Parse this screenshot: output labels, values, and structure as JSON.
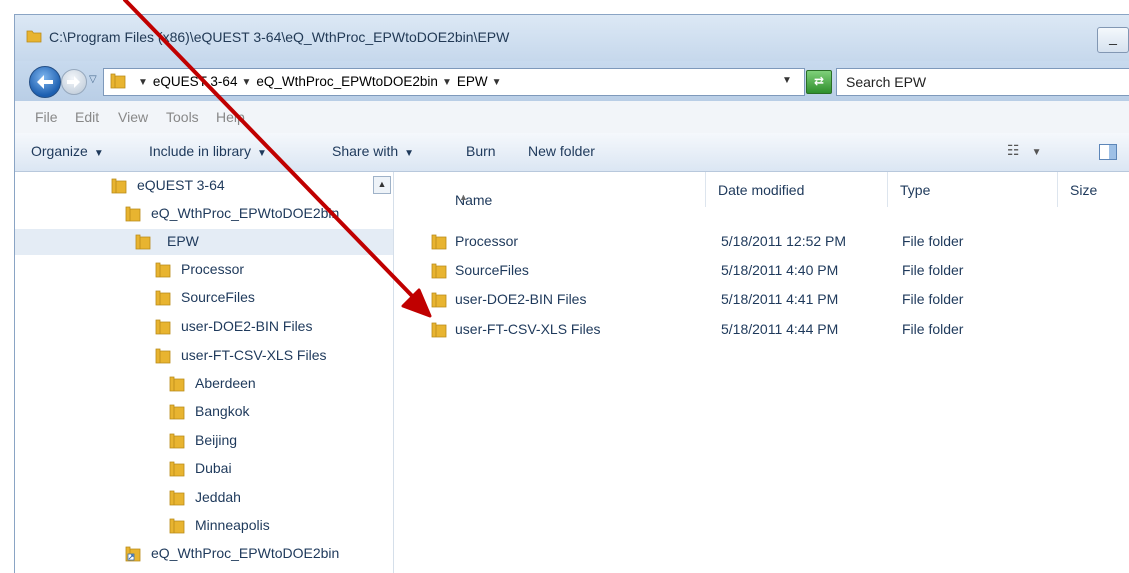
{
  "window": {
    "title": "C:\\Program Files (x86)\\eQUEST 3-64\\eQ_WthProc_EPWtoDOE2bin\\EPW",
    "minimize_label": "_"
  },
  "address": {
    "crumbs": [
      "eQUEST 3-64",
      "eQ_WthProc_EPWtoDOE2bin",
      "EPW"
    ],
    "search_placeholder": "Search EPW"
  },
  "menu": [
    "File",
    "Edit",
    "View",
    "Tools",
    "Help"
  ],
  "toolbar": {
    "organize": "Organize",
    "include": "Include in library",
    "share": "Share with",
    "burn": "Burn",
    "new_folder": "New folder"
  },
  "tree": [
    {
      "label": "eQUEST 3-64"
    },
    {
      "label": "eQ_WthProc_EPWtoDOE2bin"
    },
    {
      "label": "EPW"
    },
    {
      "label": "Processor"
    },
    {
      "label": "SourceFiles"
    },
    {
      "label": "user-DOE2-BIN Files"
    },
    {
      "label": "user-FT-CSV-XLS Files"
    },
    {
      "label": "Aberdeen"
    },
    {
      "label": "Bangkok"
    },
    {
      "label": "Beijing"
    },
    {
      "label": "Dubai"
    },
    {
      "label": "Jeddah"
    },
    {
      "label": "Minneapolis"
    },
    {
      "label": "eQ_WthProc_EPWtoDOE2bin"
    }
  ],
  "columns": {
    "name": "Name",
    "date": "Date modified",
    "type": "Type",
    "size": "Size"
  },
  "files": [
    {
      "name": "Processor",
      "date": "5/18/2011 12:52 PM",
      "type": "File folder"
    },
    {
      "name": "SourceFiles",
      "date": "5/18/2011 4:40 PM",
      "type": "File folder"
    },
    {
      "name": "user-DOE2-BIN Files",
      "date": "5/18/2011 4:41 PM",
      "type": "File folder"
    },
    {
      "name": "user-FT-CSV-XLS Files",
      "date": "5/18/2011 4:44 PM",
      "type": "File folder"
    }
  ],
  "annotation": {
    "color": "#c00000"
  },
  "colors": {
    "folder": "#e8b430",
    "selection": "#e4ecf5"
  }
}
